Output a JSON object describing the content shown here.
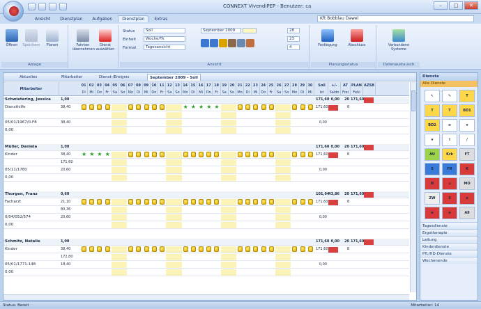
{
  "window": {
    "title": "CONNEXT VivendiPEP - Benutzer: ca"
  },
  "tabs": [
    "Ansicht",
    "Dienstplan",
    "Aufgaben",
    "Dienstplan",
    "Extras"
  ],
  "active_tab": 3,
  "unit_select": "Kft Bobblau Dawel",
  "ribbon": {
    "g1_label": "Ablage",
    "g1_btns": [
      "Öffnen",
      "Speichern",
      "Planen"
    ],
    "g2_btns": [
      "Fahrten übernehmen",
      "Dienst auswählen"
    ],
    "fields": [
      {
        "label": "Status",
        "value": "Soll"
      },
      {
        "label": "Einheit",
        "value": "Woche/Tk"
      },
      {
        "label": "Format",
        "value": "Tagesansicht"
      }
    ],
    "month": "September 2009",
    "g4_label": "Ansicht",
    "nums": [
      "28",
      "23",
      "4"
    ],
    "g5_btns": [
      "Festlegung",
      "Abschluss"
    ],
    "g5_label": "Planungsstatus",
    "g6_btn": "Verbundene Systeme",
    "g6_label": "Datenaustausch"
  },
  "doc_tabs": [
    "Aktuelles",
    "Mitarbeiter",
    "Dienst-/Ereignis",
    "September 2009 - Soll"
  ],
  "header": {
    "col1": "Mitarbeiter",
    "days": [
      "01",
      "02",
      "03",
      "04",
      "05",
      "06",
      "07",
      "08",
      "09",
      "10",
      "11",
      "12",
      "13",
      "14",
      "15",
      "16",
      "17",
      "18",
      "19",
      "20",
      "21",
      "22",
      "23",
      "24",
      "25",
      "26",
      "27",
      "28",
      "29",
      "30"
    ],
    "weekdays": [
      "Di",
      "Mi",
      "Do",
      "Fr",
      "Sa",
      "So",
      "Mo",
      "Di",
      "Mi",
      "Do",
      "Fr",
      "Sa",
      "So",
      "Mo",
      "Di",
      "Mi",
      "Do",
      "Fr",
      "Sa",
      "So",
      "Mo",
      "Di",
      "Mi",
      "Do",
      "Fr",
      "Sa",
      "So",
      "Mo",
      "Di",
      "Mi"
    ],
    "right": [
      "Soll",
      "+/-",
      "AT",
      "PLAN",
      "AZSB"
    ],
    "right2": [
      "Ist",
      "Saldo",
      "Frei",
      "Fehl",
      ""
    ]
  },
  "employees": [
    {
      "name": "Schwietering, Jessica",
      "rows": [
        [
          "1,00",
          ""
        ],
        [
          "Diensthilfe",
          "38,40"
        ],
        [
          "",
          "",
          ""
        ],
        [
          "05/01/1967/0-F8",
          "38,40"
        ],
        [
          "0,00",
          ""
        ]
      ],
      "soll": "171,60",
      "pm": "0,00",
      "at": "20",
      "plan": "171,60",
      "ist": "171,60",
      "saldo": "",
      "frei": "8"
    },
    {
      "name": "Müller, Daniela",
      "rows": [
        [
          "1,00",
          ""
        ],
        [
          "Kinder",
          "38,40"
        ],
        [
          "",
          "171,60"
        ],
        [
          "05/11/1780",
          "20,60"
        ],
        [
          "0,00",
          ""
        ]
      ],
      "soll": "171,60",
      "pm": "0,00",
      "at": "20",
      "plan": "171,60",
      "ist": "171,60",
      "saldo": "",
      "frei": "8"
    },
    {
      "name": "Thorgen, Franz",
      "rows": [
        [
          "0,60",
          ""
        ],
        [
          "Facharzt",
          "21,10"
        ],
        [
          "",
          "80,36"
        ],
        [
          "0/04/052/574",
          "20,60"
        ],
        [
          "0,00",
          ""
        ]
      ],
      "soll": "101,04",
      "pm": "43,86",
      "at": "20",
      "plan": "171,60",
      "ist": "171,60",
      "saldo": "",
      "frei": "8"
    },
    {
      "name": "Schmitz, Natalie",
      "rows": [
        [
          "1,00",
          ""
        ],
        [
          "Kinder",
          "38,40"
        ],
        [
          "",
          "172,80"
        ],
        [
          "05/01/1771-148",
          "18,40"
        ],
        [
          "0,00",
          ""
        ]
      ],
      "soll": "171,60",
      "pm": "0,00",
      "at": "20",
      "plan": "171,60",
      "ist": "171,60",
      "saldo": "",
      "frei": "8"
    }
  ],
  "right_panel": {
    "title": "Dienste",
    "sub": "Alle Dienste",
    "palette": [
      "↖",
      "✎",
      "T",
      "T",
      "T",
      "BD1",
      "BD2",
      "≡",
      "★",
      "★",
      "⇧",
      "/",
      "AU",
      "Krk",
      "FT",
      "S",
      "FR",
      "K",
      "N",
      "⌂",
      "MO",
      "ZW",
      "S",
      "⊕",
      "⊕",
      "⊕",
      "A8"
    ],
    "list": [
      "Tagesdienste",
      "Ergotherapie",
      "Leitung",
      "Kinderdienste",
      "Pfl./HD-Dienste",
      "Wochenende"
    ]
  },
  "status": {
    "left": "Status: Bereit",
    "right": "Mitarbeiter: 14"
  }
}
